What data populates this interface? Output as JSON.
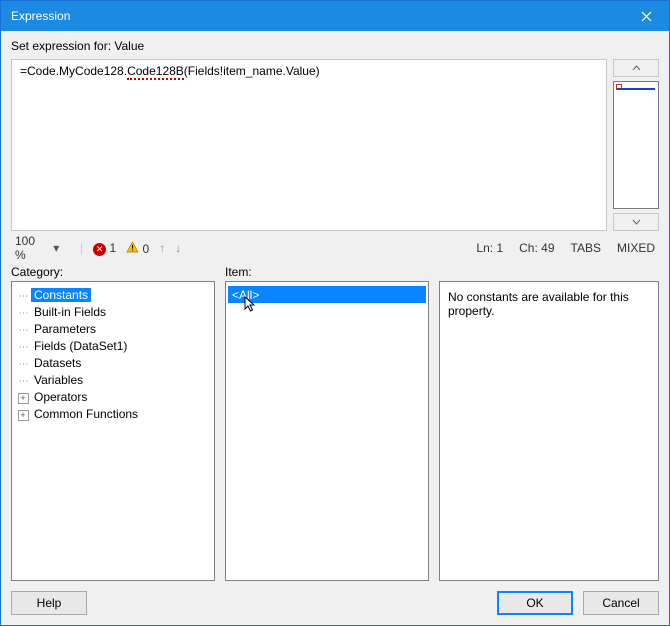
{
  "window": {
    "title": "Expression"
  },
  "header": {
    "set_for": "Set expression for: Value"
  },
  "editor": {
    "prefix": "=Code.MyCode128.",
    "underlined": "Code128B",
    "suffix": "(Fields!item_name.Value)"
  },
  "status": {
    "zoom": "100 %",
    "errors": "1",
    "warnings": "0",
    "ln_label": "Ln:",
    "ln": "1",
    "ch_label": "Ch:",
    "ch": "49",
    "tabs": "TABS",
    "mixed": "MIXED"
  },
  "labels": {
    "category": "Category:",
    "item": "Item:"
  },
  "category_tree": {
    "items": [
      {
        "label": "Constants",
        "selected": true,
        "expand": null
      },
      {
        "label": "Built-in Fields",
        "expand": null
      },
      {
        "label": "Parameters",
        "expand": null
      },
      {
        "label": "Fields (DataSet1)",
        "expand": null
      },
      {
        "label": "Datasets",
        "expand": null
      },
      {
        "label": "Variables",
        "expand": null
      },
      {
        "label": "Operators",
        "expand": "plus"
      },
      {
        "label": "Common Functions",
        "expand": "plus"
      }
    ]
  },
  "item_list": {
    "items": [
      {
        "label": "<All>",
        "selected": true
      }
    ]
  },
  "description": {
    "text": "No constants are available for this property."
  },
  "buttons": {
    "help": "Help",
    "ok": "OK",
    "cancel": "Cancel"
  }
}
